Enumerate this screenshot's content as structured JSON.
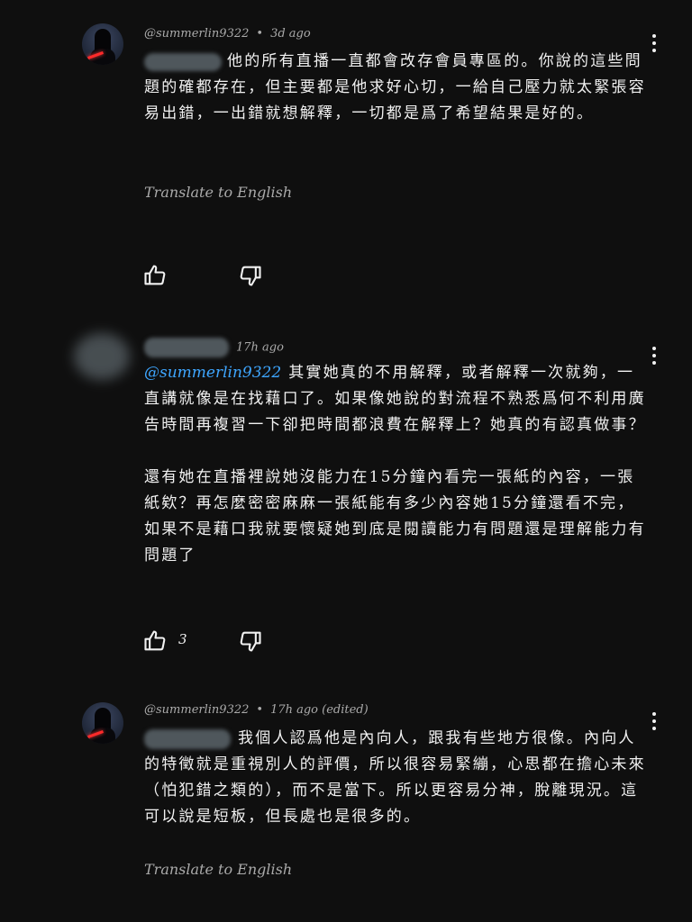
{
  "comments": [
    {
      "author": "@summerlin9322",
      "time": "3d ago",
      "text": "他的所有直播一直都會改存會員專區的。你說的這些問題的確都存在，但主要都是他求好心切，一給自己壓力就太緊張容易出錯，一出錯就想解釋，一切都是爲了希望結果是好的。",
      "translate": "Translate to English",
      "likes": ""
    },
    {
      "author": "",
      "time": "17h ago",
      "mention": "@summerlin9322",
      "paragraphs": [
        "其實她真的不用解釋，或者解釋一次就夠，一直講就像是在找藉口了。如果像她說的對流程不熟悉爲何不利用廣告時間再複習一下卻把時間都浪費在解釋上？她真的有認真做事？",
        "還有她在直播裡說她沒能力在15分鐘內看完一張紙的內容，一張紙欸？再怎麼密密麻麻一張紙能有多少內容她15分鐘還看不完，如果不是藉口我就要懷疑她到底是閱讀能力有問題還是理解能力有問題了"
      ],
      "likes": "3"
    },
    {
      "author": "@summerlin9322",
      "time": "17h ago (edited)",
      "text": "我個人認爲他是內向人，跟我有些地方很像。內向人的特徵就是重視別人的評價，所以很容易緊繃，心思都在擔心未來（怕犯錯之類的），而不是當下。所以更容易分神，脫離現況。這可以說是短板，但長處也是很多的。",
      "translate": "Translate to English"
    }
  ],
  "icons": {
    "like": "thumbs-up-icon",
    "dislike": "thumbs-down-icon",
    "more": "more-vert-icon"
  },
  "colors": {
    "background": "#0f0f0f",
    "mention": "#3ea6ff",
    "meta": "#aaaaaa"
  }
}
